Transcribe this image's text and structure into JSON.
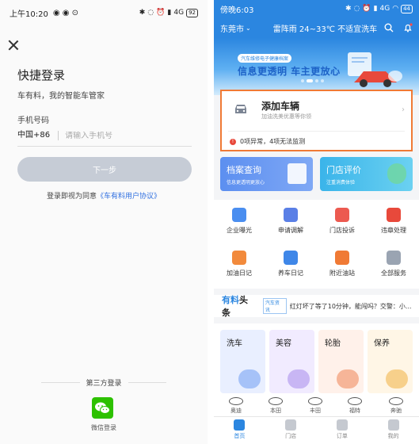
{
  "login": {
    "status": {
      "time": "上午10:20",
      "network": "4G",
      "battery": "92"
    },
    "title": "快捷登录",
    "subtitle": "车有料，我的智能车管家",
    "phone_label": "手机号码",
    "country_code": "中国+86",
    "phone_placeholder": "请输入手机号",
    "next_label": "下一步",
    "agree_prefix": "登录即视为同意",
    "agree_link": "《车有料用户协议》",
    "third_party_label": "第三方登录",
    "wechat_label": "微信登录"
  },
  "home": {
    "status": {
      "time": "傍晚6:03",
      "network": "4G",
      "battery": "44"
    },
    "city": "东莞市",
    "weather": "雷阵雨 24~33℃ 不适宜洗车",
    "banner": {
      "tag": "汽车维修电子健康档案",
      "text": "信息更透明 车主更放心",
      "slide_index": 1,
      "slide_count": 4
    },
    "add_vehicle": {
      "title": "添加车辆",
      "subtitle": "加油洗美优惠等你领",
      "warning": "0项异常，4项无法监测"
    },
    "features": [
      {
        "title": "档案查询",
        "subtitle": "信息更透明更放心",
        "icon": "document-icon"
      },
      {
        "title": "门店评价",
        "subtitle": "注重消费体验",
        "icon": "chat-bubble-icon"
      }
    ],
    "grid": [
      {
        "label": "企业曝光",
        "icon": "exposure-icon",
        "color": "#4a8ef0"
      },
      {
        "label": "申请调解",
        "icon": "mediation-icon",
        "color": "#5a7fe6"
      },
      {
        "label": "门店投诉",
        "icon": "complaint-icon",
        "color": "#ec5a50"
      },
      {
        "label": "违章处理",
        "icon": "traffic-light-icon",
        "color": "#e8493b"
      },
      {
        "label": "加油日记",
        "icon": "fuel-icon",
        "color": "#f28a3c"
      },
      {
        "label": "养车日记",
        "icon": "maintenance-icon",
        "color": "#3f87e8"
      },
      {
        "label": "附近油站",
        "icon": "gas-station-icon",
        "color": "#f07a35"
      },
      {
        "label": "全部服务",
        "icon": "all-services-icon",
        "color": "#9aa4b2"
      }
    ],
    "news": {
      "brand_a": "有料",
      "brand_b": "头条",
      "tag": "汽车资讯",
      "headline": "红灯坏了等了10分钟，能闯吗？交警：小..."
    },
    "services": [
      {
        "label": "洗车",
        "color": "#e9efff"
      },
      {
        "label": "美容",
        "color": "#f1ebff"
      },
      {
        "label": "轮胎",
        "color": "#fff1ea"
      },
      {
        "label": "保养",
        "color": "#fff6e6"
      }
    ],
    "brands": [
      "奥迪",
      "本田",
      "丰田",
      "福特",
      "奔驰"
    ],
    "tabs": [
      {
        "label": "首页",
        "active": true
      },
      {
        "label": "门店",
        "active": false
      },
      {
        "label": "订单",
        "active": false
      },
      {
        "label": "我的",
        "active": false
      }
    ]
  }
}
